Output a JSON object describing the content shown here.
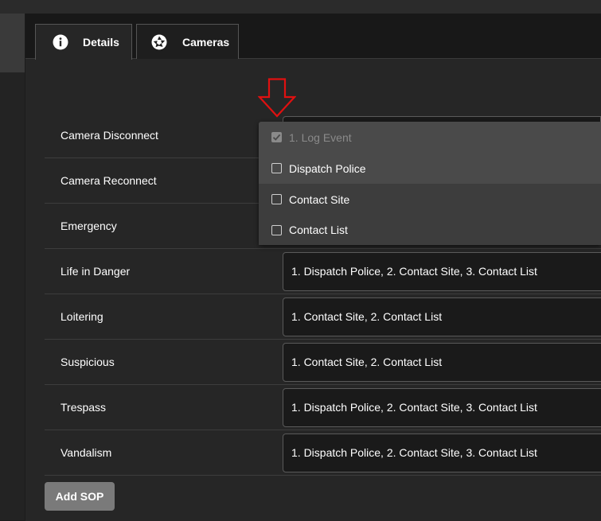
{
  "tabs": [
    {
      "label": "Details",
      "icon": "info-icon",
      "active": true
    },
    {
      "label": "Cameras",
      "icon": "camera-aperture-icon",
      "active": false
    }
  ],
  "rows": [
    {
      "label": "Camera Disconnect",
      "value": ""
    },
    {
      "label": "Camera Reconnect",
      "value": ""
    },
    {
      "label": "Emergency",
      "value": ""
    },
    {
      "label": "Life in Danger",
      "value": "1. Dispatch Police, 2. Contact Site, 3. Contact List"
    },
    {
      "label": "Loitering",
      "value": "1. Contact Site, 2. Contact List"
    },
    {
      "label": "Suspicious",
      "value": "1. Contact Site, 2. Contact List"
    },
    {
      "label": "Trespass",
      "value": "1. Dispatch Police, 2. Contact Site, 3. Contact List"
    },
    {
      "label": "Vandalism",
      "value": "1. Dispatch Police, 2. Contact Site, 3. Contact List"
    }
  ],
  "dropdown": {
    "options": [
      {
        "label": "1. Log Event",
        "checked": true,
        "disabled": true
      },
      {
        "label": "Dispatch Police",
        "checked": false,
        "disabled": false
      },
      {
        "label": "Contact Site",
        "checked": false,
        "disabled": false
      },
      {
        "label": "Contact List",
        "checked": false,
        "disabled": false
      }
    ]
  },
  "actions": {
    "add_sop_label": "Add SOP"
  },
  "colors": {
    "annotation_arrow": "#e01010",
    "button_bg": "#7a7a7a",
    "dropdown_bg": "#4a4a4a"
  }
}
